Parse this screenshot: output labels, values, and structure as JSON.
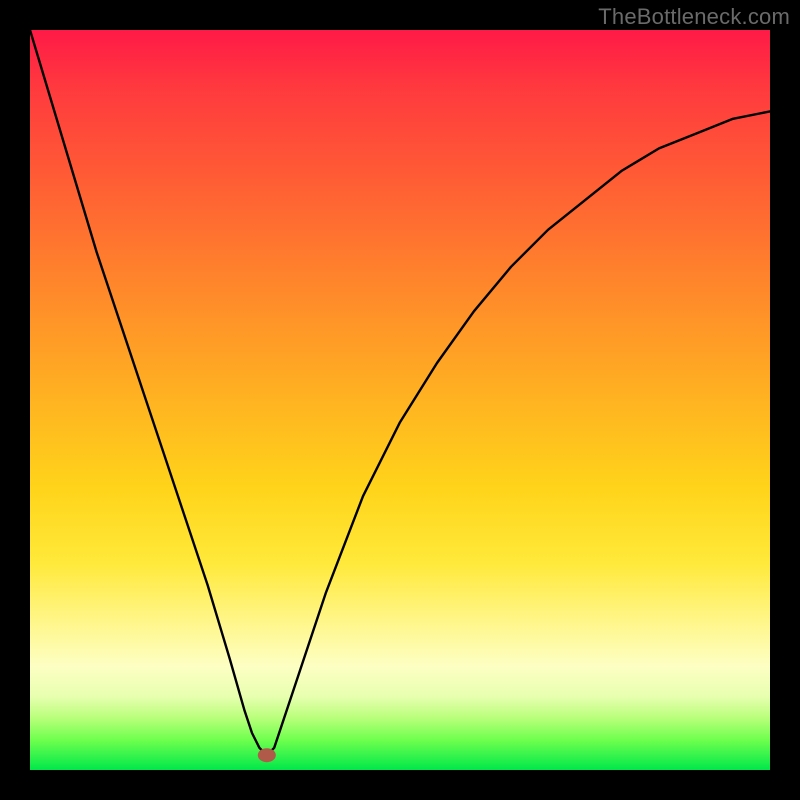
{
  "watermark": {
    "text": "TheBottleneck.com"
  },
  "colors": {
    "frame": "#000000",
    "curve": "#000000",
    "marker": "#b05a4a"
  },
  "chart_data": {
    "type": "line",
    "title": "",
    "xlabel": "",
    "ylabel": "",
    "xlim": [
      0,
      100
    ],
    "ylim": [
      0,
      100
    ],
    "grid": false,
    "legend": false,
    "marker": {
      "x": 32,
      "y": 2
    },
    "series": [
      {
        "name": "bottleneck-curve",
        "x": [
          0,
          3,
          6,
          9,
          12,
          15,
          18,
          21,
          24,
          27,
          29,
          30,
          31,
          32,
          33,
          34,
          36,
          40,
          45,
          50,
          55,
          60,
          65,
          70,
          75,
          80,
          85,
          90,
          95,
          100
        ],
        "values": [
          100,
          90,
          80,
          70,
          61,
          52,
          43,
          34,
          25,
          15,
          8,
          5,
          3,
          2,
          3,
          6,
          12,
          24,
          37,
          47,
          55,
          62,
          68,
          73,
          77,
          81,
          84,
          86,
          88,
          89
        ]
      }
    ]
  }
}
